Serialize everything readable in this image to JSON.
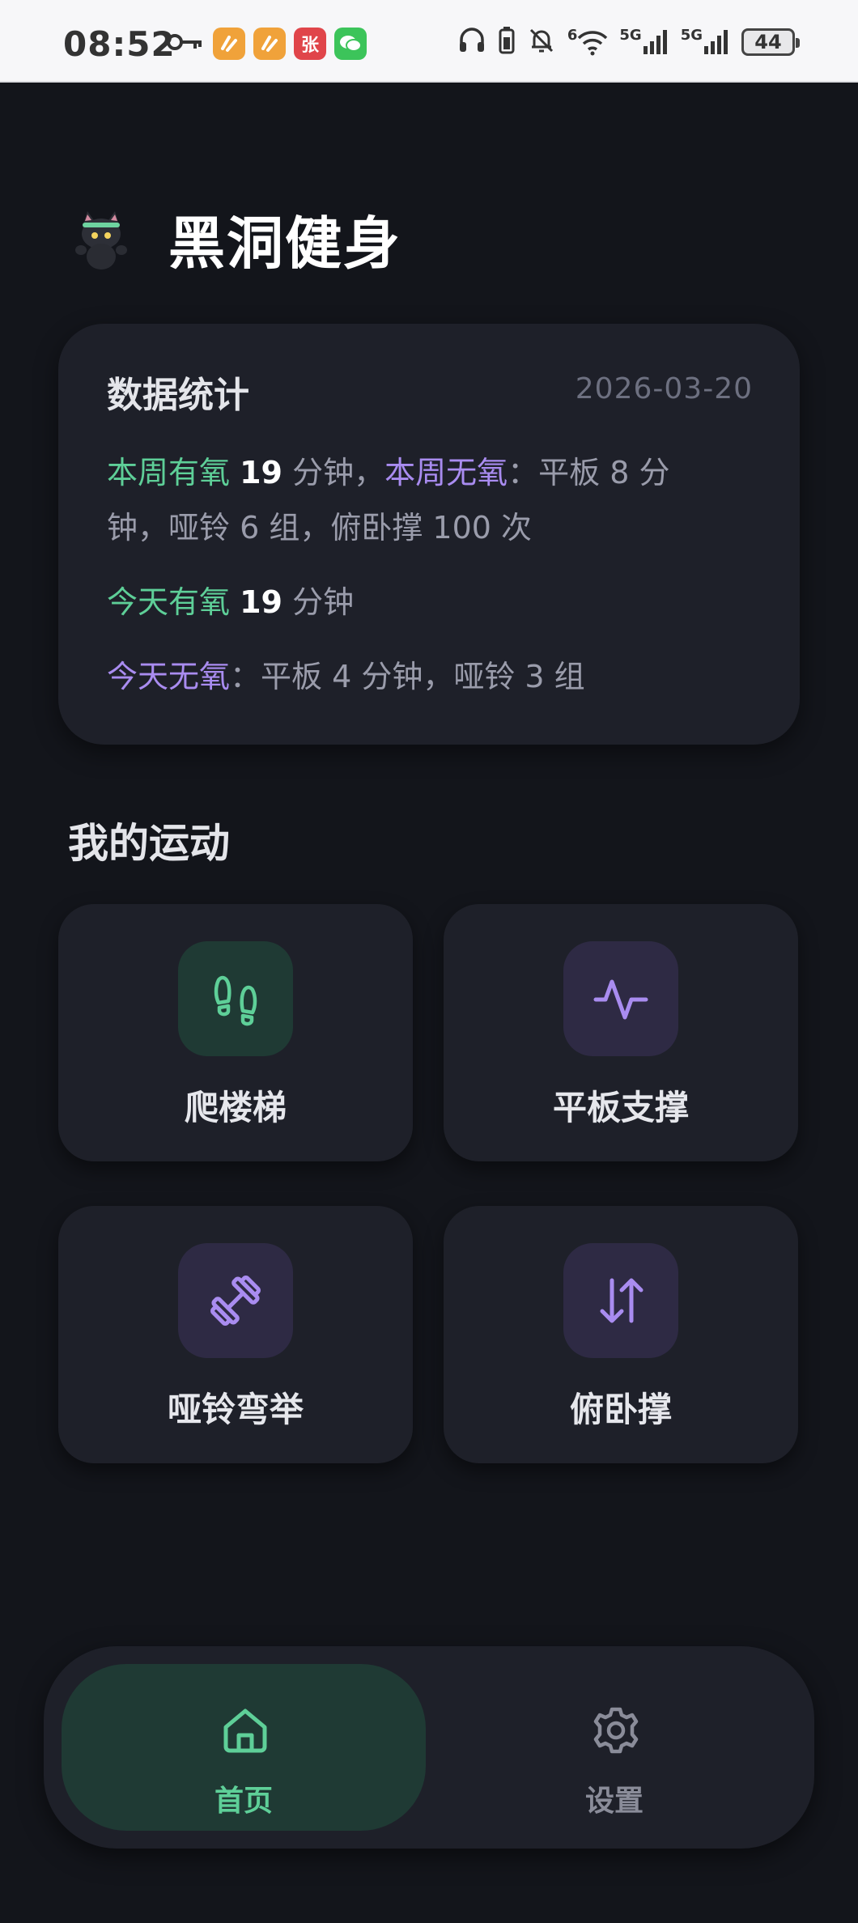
{
  "status_bar": {
    "time": "08:52",
    "app_badge_3": "张",
    "network_1": "5G",
    "network_2": "5G",
    "battery": "44",
    "wifi_label": "6"
  },
  "header": {
    "title": "黑洞健身"
  },
  "stats": {
    "title": "数据统计",
    "date": "2026-03-20",
    "week_aerobic_label": "本周有氧",
    "week_aerobic_value": "19",
    "week_aerobic_unit": " 分钟，",
    "week_anaerobic_label": "本周无氧",
    "week_anaerobic_detail_1": "：平板 8 分",
    "week_anaerobic_detail_2": "钟，哑铃 6 组，俯卧撑 100 次",
    "today_aerobic_label": "今天有氧",
    "today_aerobic_value": "19",
    "today_aerobic_unit": " 分钟",
    "today_anaerobic_label": "今天无氧",
    "today_anaerobic_detail": "：平板 4 分钟，哑铃 3 组"
  },
  "exercises": {
    "section_title": "我的运动",
    "items": [
      {
        "label": "爬楼梯",
        "icon": "footprints-icon"
      },
      {
        "label": "平板支撑",
        "icon": "activity-icon"
      },
      {
        "label": "哑铃弯举",
        "icon": "dumbbell-icon"
      },
      {
        "label": "俯卧撑",
        "icon": "arrows-up-down-icon"
      }
    ]
  },
  "nav": {
    "home_label": "首页",
    "settings_label": "设置"
  },
  "colors": {
    "background": "#13151b",
    "card": "#1e2029",
    "accent_green": "#5ecf98",
    "accent_purple": "#a98cf0"
  }
}
